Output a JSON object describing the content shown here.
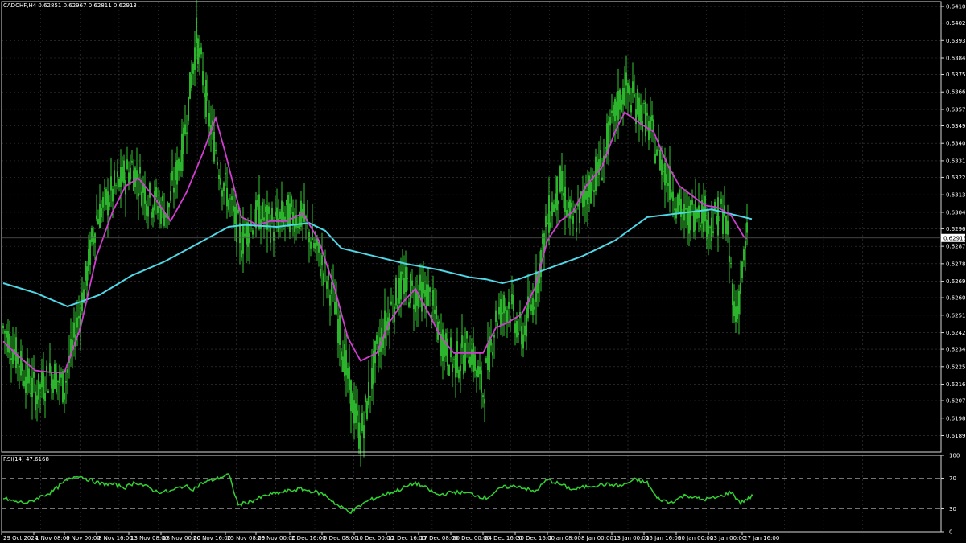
{
  "header": {
    "title": "CADCHF,H4  0.62851 0.62967 0.62811 0.62913",
    "rsi_title": "RSI(14) 47.6168"
  },
  "colors": {
    "background": "#000000",
    "grid": "#3a3a3a",
    "frame": "#d8d8d8",
    "candle": "#32c832",
    "ma_fast": "#d23cd2",
    "ma_slow": "#50d8e8",
    "rsi": "#32d232",
    "price_label_bg": "#ffffff"
  },
  "chart_data": [
    {
      "type": "candlestick",
      "symbol": "CADCHF",
      "timeframe": "H4",
      "current_price": "0.62913",
      "ylim": [
        0.6181,
        0.6413
      ],
      "y_ticks": [
        "0.64105",
        "0.64020",
        "0.63930",
        "0.63840",
        "0.63755",
        "0.63665",
        "0.63575",
        "0.63490",
        "0.63400",
        "0.63310",
        "0.63225",
        "0.63135",
        "0.63045",
        "0.62960",
        "0.62870",
        "0.62780",
        "0.62690",
        "0.62605",
        "0.62515",
        "0.62425",
        "0.62340",
        "0.62250",
        "0.62160",
        "0.62075",
        "0.61985",
        "0.61895"
      ],
      "x_ticks": [
        "29 Oct 2024",
        "1 Nov 08:00",
        "6 Nov 00:00",
        "8 Nov 16:00",
        "13 Nov 08:00",
        "18 Nov 00:00",
        "20 Nov 16:00",
        "25 Nov 08:00",
        "28 Nov 00:00",
        "2 Dec 16:00",
        "5 Dec 08:00",
        "10 Dec 00:00",
        "12 Dec 16:00",
        "17 Dec 08:00",
        "20 Dec 00:00",
        "24 Dec 16:00",
        "30 Dec 16:00",
        "3 Jan 08:00",
        "8 Jan 00:00",
        "13 Jan 00:00",
        "15 Jan 16:00",
        "20 Jan 00:00",
        "23 Jan 00:00",
        "27 Jan 16:00"
      ],
      "price_path": [
        [
          0,
          0.6245
        ],
        [
          10,
          0.6228
        ],
        [
          20,
          0.6211
        ],
        [
          30,
          0.6222
        ],
        [
          38,
          0.6215
        ],
        [
          48,
          0.6255
        ],
        [
          58,
          0.6302
        ],
        [
          68,
          0.6315
        ],
        [
          80,
          0.6328
        ],
        [
          90,
          0.6312
        ],
        [
          102,
          0.6305
        ],
        [
          112,
          0.634
        ],
        [
          120,
          0.6395
        ],
        [
          128,
          0.6352
        ],
        [
          136,
          0.6322
        ],
        [
          148,
          0.629
        ],
        [
          158,
          0.6304
        ],
        [
          168,
          0.6298
        ],
        [
          176,
          0.6303
        ],
        [
          186,
          0.6302
        ],
        [
          196,
          0.6282
        ],
        [
          206,
          0.6258
        ],
        [
          214,
          0.6218
        ],
        [
          222,
          0.6188
        ],
        [
          232,
          0.6232
        ],
        [
          240,
          0.6253
        ],
        [
          248,
          0.6268
        ],
        [
          256,
          0.6262
        ],
        [
          264,
          0.6262
        ],
        [
          272,
          0.624
        ],
        [
          280,
          0.6226
        ],
        [
          290,
          0.6235
        ],
        [
          298,
          0.6212
        ],
        [
          306,
          0.625
        ],
        [
          314,
          0.6258
        ],
        [
          322,
          0.624
        ],
        [
          330,
          0.6262
        ],
        [
          338,
          0.63
        ],
        [
          346,
          0.6318
        ],
        [
          354,
          0.6298
        ],
        [
          364,
          0.6318
        ],
        [
          372,
          0.633
        ],
        [
          380,
          0.6355
        ],
        [
          386,
          0.6368
        ],
        [
          394,
          0.636
        ],
        [
          402,
          0.6347
        ],
        [
          410,
          0.6328
        ],
        [
          418,
          0.6312
        ],
        [
          424,
          0.63
        ],
        [
          432,
          0.6308
        ],
        [
          440,
          0.6298
        ],
        [
          448,
          0.6305
        ],
        [
          455,
          0.625
        ],
        [
          462,
          0.6291
        ]
      ],
      "ma_fast": [
        [
          0,
          0.6238
        ],
        [
          10,
          0.623
        ],
        [
          20,
          0.6223
        ],
        [
          30,
          0.6222
        ],
        [
          38,
          0.6222
        ],
        [
          48,
          0.6245
        ],
        [
          58,
          0.6282
        ],
        [
          68,
          0.6305
        ],
        [
          76,
          0.6318
        ],
        [
          84,
          0.6322
        ],
        [
          94,
          0.6312
        ],
        [
          104,
          0.63
        ],
        [
          114,
          0.6315
        ],
        [
          124,
          0.6335
        ],
        [
          132,
          0.6353
        ],
        [
          138,
          0.6335
        ],
        [
          148,
          0.6302
        ],
        [
          158,
          0.6298
        ],
        [
          166,
          0.63
        ],
        [
          176,
          0.63
        ],
        [
          186,
          0.6304
        ],
        [
          196,
          0.629
        ],
        [
          206,
          0.6265
        ],
        [
          214,
          0.624
        ],
        [
          222,
          0.6228
        ],
        [
          232,
          0.6232
        ],
        [
          240,
          0.6248
        ],
        [
          248,
          0.6258
        ],
        [
          256,
          0.6265
        ],
        [
          264,
          0.6253
        ],
        [
          272,
          0.624
        ],
        [
          280,
          0.6232
        ],
        [
          290,
          0.6232
        ],
        [
          298,
          0.6232
        ],
        [
          306,
          0.6245
        ],
        [
          314,
          0.6248
        ],
        [
          322,
          0.6252
        ],
        [
          330,
          0.6265
        ],
        [
          338,
          0.629
        ],
        [
          346,
          0.63
        ],
        [
          354,
          0.6305
        ],
        [
          362,
          0.6318
        ],
        [
          372,
          0.6328
        ],
        [
          380,
          0.6346
        ],
        [
          386,
          0.6356
        ],
        [
          396,
          0.635
        ],
        [
          404,
          0.6346
        ],
        [
          412,
          0.633
        ],
        [
          420,
          0.6318
        ],
        [
          428,
          0.6313
        ],
        [
          436,
          0.6308
        ],
        [
          444,
          0.6307
        ],
        [
          452,
          0.6303
        ],
        [
          460,
          0.6292
        ],
        [
          462,
          0.6291
        ]
      ],
      "ma_slow": [
        [
          0,
          0.6268
        ],
        [
          20,
          0.6263
        ],
        [
          40,
          0.6256
        ],
        [
          60,
          0.6262
        ],
        [
          80,
          0.6272
        ],
        [
          100,
          0.6279
        ],
        [
          120,
          0.6288
        ],
        [
          140,
          0.6297
        ],
        [
          150,
          0.6298
        ],
        [
          170,
          0.6297
        ],
        [
          190,
          0.6299
        ],
        [
          200,
          0.6295
        ],
        [
          210,
          0.6286
        ],
        [
          230,
          0.6282
        ],
        [
          250,
          0.6278
        ],
        [
          270,
          0.6275
        ],
        [
          290,
          0.6271
        ],
        [
          300,
          0.627
        ],
        [
          310,
          0.6268
        ],
        [
          320,
          0.627
        ],
        [
          340,
          0.6276
        ],
        [
          360,
          0.6282
        ],
        [
          380,
          0.629
        ],
        [
          400,
          0.6302
        ],
        [
          420,
          0.6304
        ],
        [
          440,
          0.6306
        ],
        [
          455,
          0.6303
        ],
        [
          465,
          0.6301
        ]
      ]
    },
    {
      "type": "line",
      "indicator": "RSI(14)",
      "value": "47.6168",
      "ylim": [
        0,
        100
      ],
      "levels": [
        30,
        70
      ],
      "y_ticks": [
        "100",
        "70",
        "30",
        "0"
      ],
      "values": [
        [
          0,
          44
        ],
        [
          8,
          39
        ],
        [
          16,
          38
        ],
        [
          22,
          45
        ],
        [
          30,
          52
        ],
        [
          38,
          65
        ],
        [
          46,
          74
        ],
        [
          52,
          69
        ],
        [
          60,
          63
        ],
        [
          68,
          62
        ],
        [
          76,
          58
        ],
        [
          82,
          65
        ],
        [
          90,
          58
        ],
        [
          96,
          52
        ],
        [
          104,
          53
        ],
        [
          112,
          60
        ],
        [
          118,
          56
        ],
        [
          124,
          64
        ],
        [
          132,
          69
        ],
        [
          140,
          75
        ],
        [
          146,
          35
        ],
        [
          154,
          40
        ],
        [
          164,
          48
        ],
        [
          174,
          52
        ],
        [
          184,
          56
        ],
        [
          194,
          52
        ],
        [
          200,
          48
        ],
        [
          208,
          34
        ],
        [
          216,
          26
        ],
        [
          226,
          40
        ],
        [
          236,
          48
        ],
        [
          246,
          55
        ],
        [
          256,
          64
        ],
        [
          262,
          58
        ],
        [
          270,
          48
        ],
        [
          280,
          52
        ],
        [
          290,
          50
        ],
        [
          300,
          44
        ],
        [
          310,
          58
        ],
        [
          320,
          60
        ],
        [
          330,
          52
        ],
        [
          338,
          68
        ],
        [
          346,
          62
        ],
        [
          354,
          55
        ],
        [
          364,
          60
        ],
        [
          374,
          62
        ],
        [
          384,
          60
        ],
        [
          392,
          68
        ],
        [
          400,
          64
        ],
        [
          406,
          44
        ],
        [
          414,
          38
        ],
        [
          424,
          48
        ],
        [
          434,
          42
        ],
        [
          444,
          45
        ],
        [
          452,
          52
        ],
        [
          458,
          38
        ],
        [
          466,
          47.6
        ]
      ]
    }
  ]
}
